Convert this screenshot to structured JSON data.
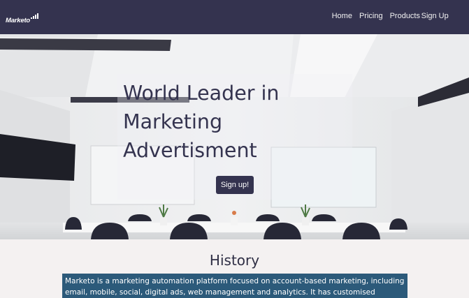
{
  "brand": {
    "name": "Marketo"
  },
  "nav": {
    "links": [
      "Home",
      "Pricing",
      "Products",
      "Sign Up"
    ]
  },
  "hero": {
    "title": "World Leader in Marketing Advertisment",
    "button": "Sign up!"
  },
  "history": {
    "title": "History",
    "text": "Marketo is a marketing automation platform focused on account-based marketing, including email, mobile, social, digital ads, web management and analytics. It has customised solutions for different industries"
  },
  "colors": {
    "nav_bg": "#34334f",
    "accent": "#34334f",
    "text_highlight": "#2c5a7a"
  }
}
